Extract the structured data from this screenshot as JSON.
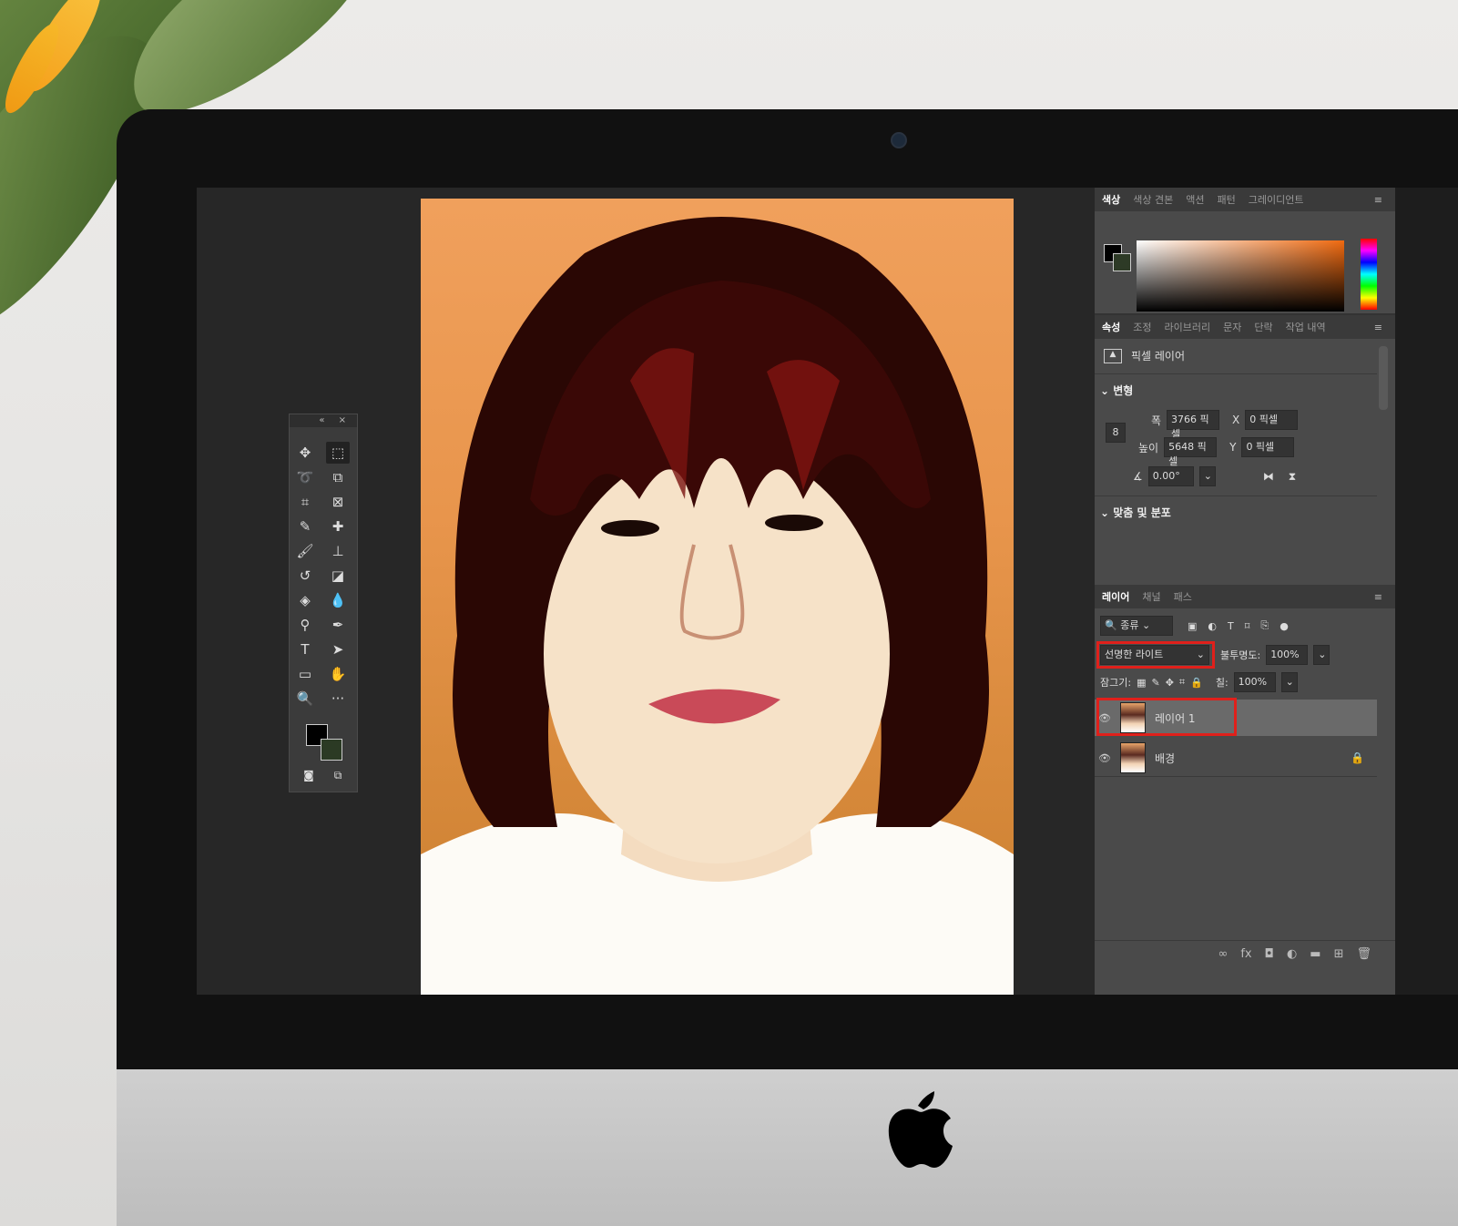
{
  "app": {
    "color_tabs": [
      "색상",
      "색상 견본",
      "액션",
      "패턴",
      "그레이디언트"
    ],
    "properties_tabs": [
      "속성",
      "조정",
      "라이브러리",
      "문자",
      "단락",
      "작업 내역"
    ],
    "layers_tabs": [
      "레이어",
      "채널",
      "패스"
    ],
    "colors": {
      "accent_red": "#e0201b",
      "panel": "#4a4a4a",
      "workspace": "#272727"
    }
  },
  "properties": {
    "layer_type": "픽셀 레이어",
    "transform_section": "변형",
    "width_label": "폭",
    "width_value": "3766 픽셀",
    "height_label": "높이",
    "height_value": "5648 픽셀",
    "x_label": "X",
    "x_value": "0 픽셀",
    "y_label": "Y",
    "y_value": "0 픽셀",
    "angle_value": "0.00°",
    "align_section": "맞춤 및 분포"
  },
  "layers": {
    "filter_kind": "종류",
    "blend_mode": "선명한 라이트",
    "opacity_label": "불투명도:",
    "opacity_value": "100%",
    "lock_label": "잠그기:",
    "fill_label": "칠:",
    "fill_value": "100%",
    "items": [
      {
        "name": "레이어 1",
        "selected": true
      },
      {
        "name": "배경",
        "selected": false,
        "locked": true
      }
    ]
  },
  "toolbox": {
    "tools": [
      "move-icon",
      "marquee-icon",
      "lasso-icon",
      "object-select-icon",
      "crop-icon",
      "frame-icon",
      "eyedropper-icon",
      "healing-icon",
      "brush-icon",
      "stamp-icon",
      "history-brush-icon",
      "eraser-icon",
      "bucket-icon",
      "blur-icon",
      "dodge-icon",
      "pen-icon",
      "text-icon",
      "path-select-icon",
      "rectangle-icon",
      "hand-icon",
      "zoom-icon",
      "more-icon"
    ],
    "text_tool_glyph": "T"
  }
}
